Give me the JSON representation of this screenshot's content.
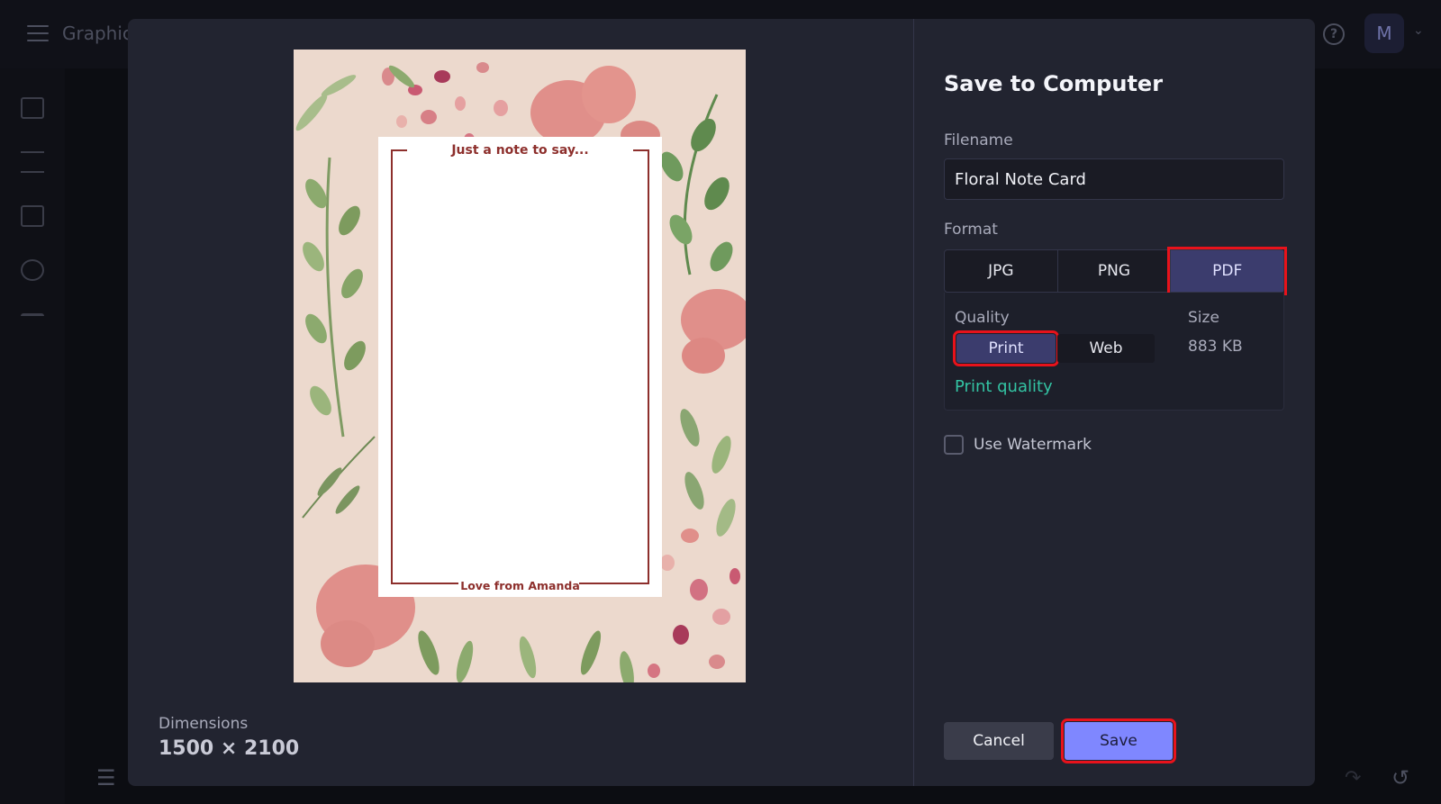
{
  "app": {
    "name": "Graphic",
    "avatar_initial": "M"
  },
  "dialog": {
    "title": "Save to Computer",
    "filename_label": "Filename",
    "filename_value": "Floral Note Card",
    "format_label": "Format",
    "formats": [
      "JPG",
      "PNG",
      "PDF"
    ],
    "selected_format": "PDF",
    "quality_label": "Quality",
    "quality_options": [
      "Print",
      "Web"
    ],
    "selected_quality": "Print",
    "size_label": "Size",
    "size_value": "883 KB",
    "quality_description": "Print quality",
    "watermark_label": "Use Watermark",
    "watermark_checked": false,
    "cancel_label": "Cancel",
    "save_label": "Save"
  },
  "preview": {
    "card_top_text": "Just a note to say...",
    "card_bottom_text": "Love from Amanda",
    "dimensions_label": "Dimensions",
    "dimensions_value": "1500 × 2100"
  },
  "colors": {
    "accent": "#7f87ff",
    "selected": "#3b3c6d",
    "highlight": "#e8121b",
    "teal": "#33c3a3",
    "card_text": "#8d2f2c"
  }
}
